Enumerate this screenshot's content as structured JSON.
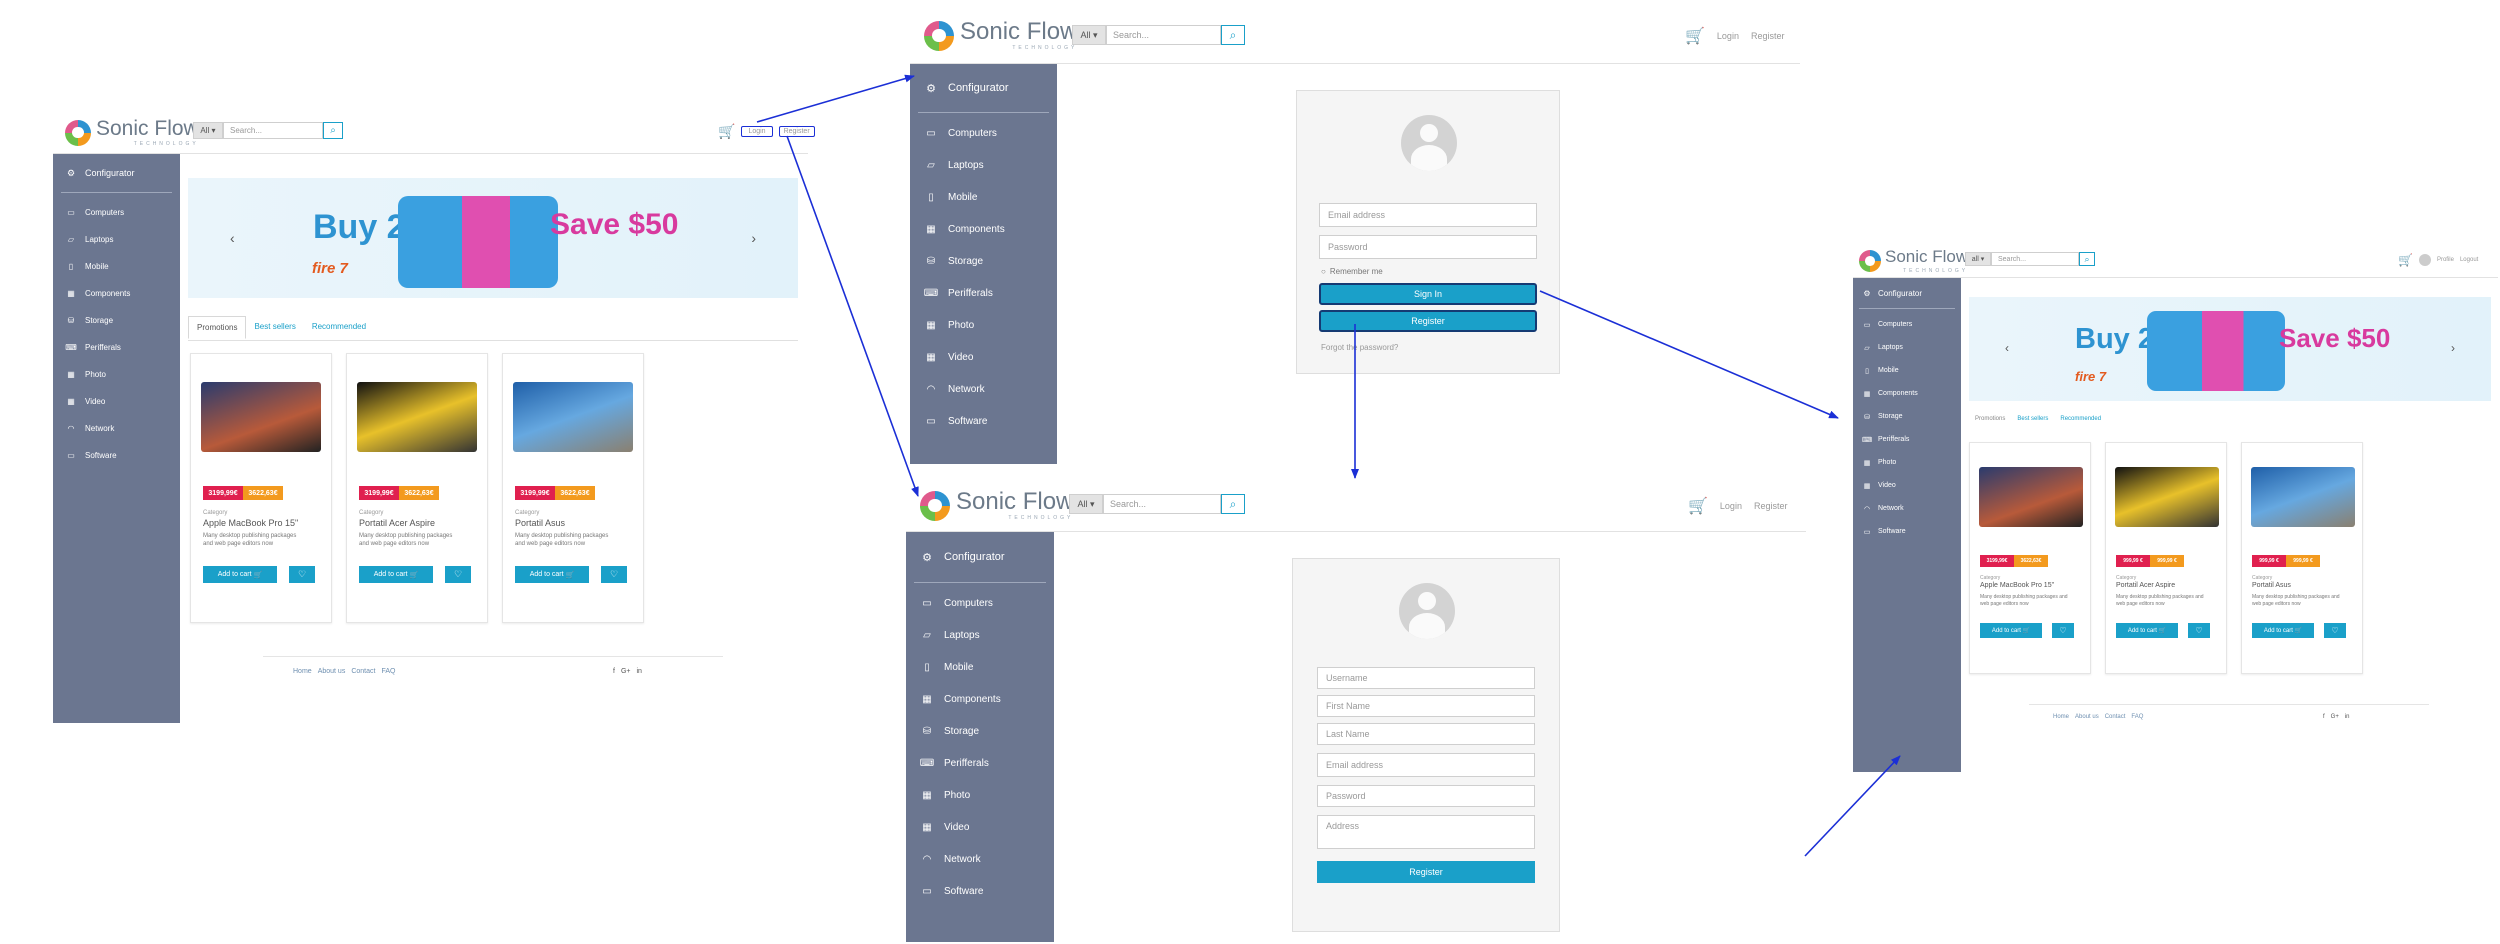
{
  "brand": {
    "name": "Sonic Flow",
    "tagline": "TECHNOLOGY"
  },
  "search": {
    "select_label": "All",
    "select_label_alt": "all",
    "placeholder": "Search..."
  },
  "nav": {
    "login": "Login",
    "register": "Register",
    "profile": "Profile",
    "logout": "Logout"
  },
  "sidebar": {
    "configurator": "Configurator",
    "items": [
      {
        "label": "Computers",
        "icon": "desktop-icon"
      },
      {
        "label": "Laptops",
        "icon": "laptop-icon"
      },
      {
        "label": "Mobile",
        "icon": "mobile-icon"
      },
      {
        "label": "Components",
        "icon": "calendar-icon"
      },
      {
        "label": "Storage",
        "icon": "hdd-icon"
      },
      {
        "label": "Perifferals",
        "icon": "keyboard-icon"
      },
      {
        "label": "Photo",
        "icon": "calendar-icon"
      },
      {
        "label": "Video",
        "icon": "calendar-icon"
      },
      {
        "label": "Network",
        "icon": "rss-icon"
      },
      {
        "label": "Software",
        "icon": "window-icon"
      }
    ]
  },
  "banner": {
    "buy": "Buy 2",
    "save": "Save $50",
    "product": "fire 7"
  },
  "tabs": [
    "Promotions",
    "Best sellers",
    "Recommended"
  ],
  "products": [
    {
      "category": "Category",
      "name": "Apple MacBook Pro 15\"",
      "price": "3199,99€",
      "old": "3622,63€",
      "desc": "Many desktop publishing packages and web page editors now"
    },
    {
      "category": "Category",
      "name": "Portatil Acer Aspire",
      "price": "3199,99€",
      "old": "3622,63€",
      "desc": "Many desktop publishing packages and web page editors now"
    },
    {
      "category": "Category",
      "name": "Portatil Asus",
      "price": "3199,99€",
      "old": "3622,63€",
      "desc": "Many desktop publishing packages and web page editors now"
    }
  ],
  "products_alt": [
    {
      "price": "3199,99€",
      "old": "3622,63€"
    },
    {
      "price": "999,99 €",
      "old": "999,99 €"
    },
    {
      "price": "999,99 €",
      "old": "999,99 €"
    }
  ],
  "card_actions": {
    "add_to_cart": "Add to cart"
  },
  "footer": {
    "links": [
      "Home",
      "About us",
      "Contact",
      "FAQ"
    ]
  },
  "login_form": {
    "email": "Email address",
    "password": "Password",
    "remember": "Remember me",
    "sign_in": "Sign In",
    "register": "Register",
    "forgot": "Forgot the password?"
  },
  "register_form": {
    "username": "Username",
    "first_name": "First Name",
    "last_name": "Last Name",
    "email": "Email address",
    "password": "Password",
    "address": "Address",
    "register": "Register"
  },
  "colors": {
    "sidebar": "#6b7690",
    "accent": "#1aa0c9",
    "cart": "#f28c1a",
    "price": "#e0204f",
    "old_price": "#f39a1e",
    "arrow": "#1b2fd6"
  }
}
